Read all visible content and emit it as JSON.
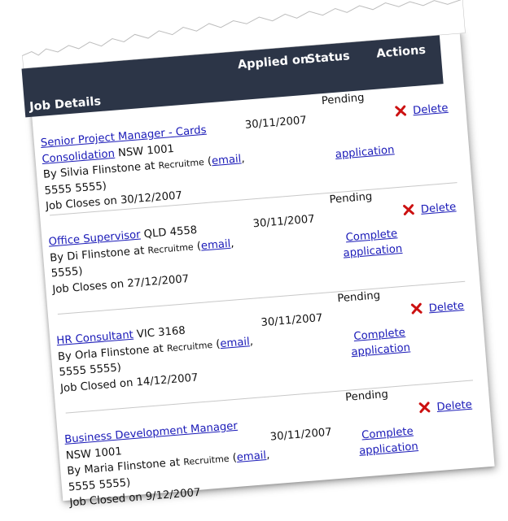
{
  "table": {
    "header": {
      "job_details": "Job Details",
      "applied_on": "Applied on",
      "status": "Status",
      "actions": "Actions"
    },
    "icon": "red-x-delete-icon",
    "rows": [
      {
        "title": "Senior Project Manager - Cards Consolidation",
        "location": "NSW 1001",
        "by": "By Silvia Flinstone at",
        "company": "Recruitme",
        "email": "email",
        "phone": "5555 5555)",
        "closes": "Job Closes on 30/12/2007",
        "applied_on": "30/11/2007",
        "status": "Pending",
        "complete": "",
        "application": "application",
        "delete": "Delete"
      },
      {
        "title": "Office Supervisor",
        "location": "QLD 4558",
        "by": "By Di Flinstone at",
        "company": "Recruitme",
        "email": "email",
        "phone": "5555)",
        "closes": "Job Closes on 27/12/2007",
        "applied_on": "30/11/2007",
        "status": "Pending",
        "complete": "Complete",
        "application": "application",
        "delete": "Delete"
      },
      {
        "title": "HR Consultant",
        "location": "VIC 3168",
        "by": "By Orla Flinstone at",
        "company": "Recruitme",
        "email": "email",
        "phone": "5555 5555)",
        "closes": "Job Closed on 14/12/2007",
        "applied_on": "30/11/2007",
        "status": "Pending",
        "complete": "Complete",
        "application": "application",
        "delete": "Delete"
      },
      {
        "title": "Business Development Manager",
        "location": "NSW 1001",
        "by": "By Maria Flinstone at",
        "company": "Recruitme",
        "email": "email",
        "phone": "5555 5555)",
        "closes": "Job Closed on 9/12/2007",
        "applied_on": "30/11/2007",
        "status": "Pending",
        "complete": "Complete",
        "application": "application",
        "delete": "Delete"
      }
    ]
  }
}
